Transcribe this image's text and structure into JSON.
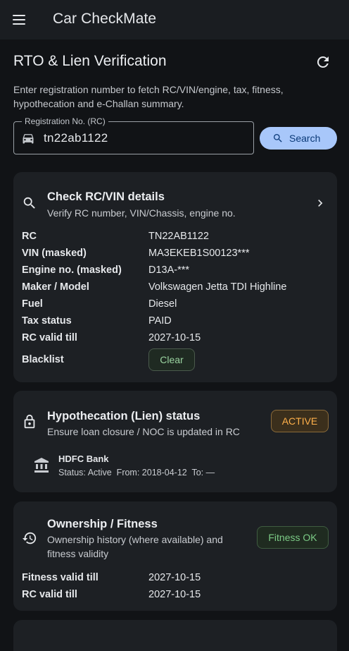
{
  "app": {
    "title": "Car CheckMate"
  },
  "page": {
    "title": "RTO & Lien Verification",
    "description": "Enter registration number to fetch RC/VIN/engine, tax, fitness, hypothecation and e-Challan summary."
  },
  "search": {
    "label": "Registration No. (RC)",
    "value": "tn22ab1122",
    "button_label": "Search"
  },
  "rc_card": {
    "title": "Check RC/VIN details",
    "subtitle": "Verify RC number, VIN/Chassis, engine no.",
    "rows": [
      {
        "key": "RC",
        "value": "TN22AB1122"
      },
      {
        "key": "VIN (masked)",
        "value": "MA3EKEB1S00123***"
      },
      {
        "key": "Engine no. (masked)",
        "value": "D13A-***"
      },
      {
        "key": "Maker / Model",
        "value": "Volkswagen Jetta TDI Highline"
      },
      {
        "key": "Fuel",
        "value": "Diesel"
      },
      {
        "key": "Tax status",
        "value": "PAID"
      },
      {
        "key": "RC valid till",
        "value": "2027-10-15"
      }
    ],
    "blacklist_label": "Blacklist",
    "blacklist_value": "Clear"
  },
  "lien_card": {
    "title": "Hypothecation (Lien) status",
    "subtitle": "Ensure loan closure / NOC is updated in RC",
    "status": "ACTIVE",
    "bank": {
      "name": "HDFC Bank",
      "status_line": "Status: Active  From: 2018-04-12  To: —"
    }
  },
  "ownership_card": {
    "title": "Ownership / Fitness",
    "subtitle": "Ownership history (where available) and fitness validity",
    "status": "Fitness OK",
    "rows": [
      {
        "key": "Fitness valid till",
        "value": "2027-10-15"
      },
      {
        "key": "RC valid till",
        "value": "2027-10-15"
      }
    ]
  },
  "colors": {
    "background": "#111316",
    "card": "#1d2024",
    "accent": "#a8c7fa",
    "active": "#ffb04a",
    "ok": "#7ccb86"
  }
}
